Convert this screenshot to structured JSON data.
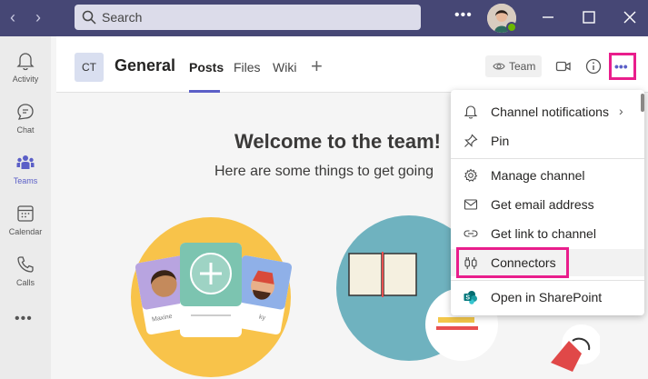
{
  "titlebar": {
    "search_placeholder": "Search",
    "more": "•••",
    "colors": {
      "bar": "#464775",
      "presence": "#6bb700"
    }
  },
  "rail": {
    "items": [
      {
        "label": "Activity",
        "icon": "bell-icon"
      },
      {
        "label": "Chat",
        "icon": "chat-icon"
      },
      {
        "label": "Teams",
        "icon": "teams-icon",
        "active": true
      },
      {
        "label": "Calendar",
        "icon": "calendar-icon"
      },
      {
        "label": "Calls",
        "icon": "phone-icon"
      }
    ],
    "more": "•••"
  },
  "channel": {
    "badge": "CT",
    "title": "General",
    "tabs": [
      {
        "label": "Posts",
        "active": true
      },
      {
        "label": "Files"
      },
      {
        "label": "Wiki"
      }
    ],
    "add_tab": "+",
    "team_button": "Team",
    "more": "•••"
  },
  "content": {
    "welcome": "Welcome to the team!",
    "subtitle": "Here are some things to get going",
    "card_names": [
      "Maxine",
      "ky"
    ]
  },
  "menu": {
    "items": [
      {
        "label": "Channel notifications",
        "icon": "bell-icon",
        "submenu": true
      },
      {
        "label": "Pin",
        "icon": "pin-icon"
      },
      {
        "label": "Manage channel",
        "icon": "gear-icon"
      },
      {
        "label": "Get email address",
        "icon": "mail-icon"
      },
      {
        "label": "Get link to channel",
        "icon": "link-icon"
      },
      {
        "label": "Connectors",
        "icon": "connectors-icon",
        "highlighted": true
      },
      {
        "label": "Open in SharePoint",
        "icon": "sharepoint-icon"
      }
    ]
  },
  "accent": "#5b5fc7",
  "highlight_color": "#e91e8c"
}
